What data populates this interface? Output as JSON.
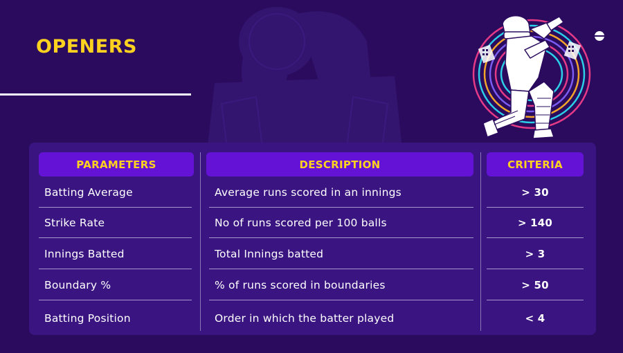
{
  "title": "OPENERS",
  "colors": {
    "background": "#2a0b5e",
    "panel": "#3a1582",
    "header_pill": "#6312d6",
    "accent_yellow": "#ffd21f"
  },
  "icons": {
    "hero": "cricket-batter-icon",
    "ball": "cricket-ball-icon",
    "background": "cricket-helmet-watermark-icon"
  },
  "table": {
    "headers": {
      "parameters": "PARAMETERS",
      "description": "DESCRIPTION",
      "criteria": "CRITERIA"
    },
    "rows": [
      {
        "parameter": "Batting Average",
        "description": "Average runs scored in an innings",
        "criteria": "> 30"
      },
      {
        "parameter": "Strike Rate",
        "description": "No of runs scored per 100 balls",
        "criteria": "> 140"
      },
      {
        "parameter": "Innings Batted",
        "description": "Total Innings batted",
        "criteria": "> 3"
      },
      {
        "parameter": "Boundary %",
        "description": "% of runs scored in boundaries",
        "criteria": "> 50"
      },
      {
        "parameter": "Batting Position",
        "description": "Order in which the batter played",
        "criteria": "< 4"
      }
    ]
  }
}
